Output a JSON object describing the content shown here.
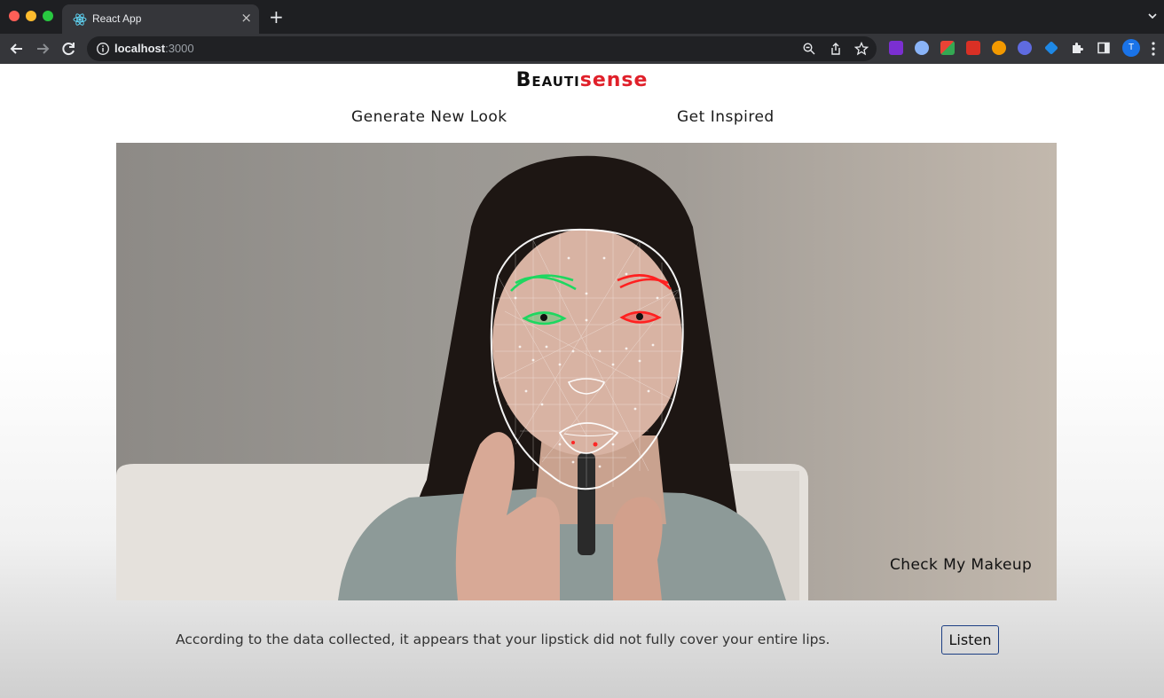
{
  "browser": {
    "tab_title": "React App",
    "url_host": "localhost",
    "url_port": ":3000",
    "profile_initial": "T"
  },
  "header": {
    "logo_part1": "Beauti",
    "logo_part2": "sense",
    "brand_colors": {
      "dark": "#111111",
      "accent": "#e0202a"
    }
  },
  "nav": {
    "items": [
      {
        "label": "Generate New Look"
      },
      {
        "label": "Get Inspired"
      }
    ]
  },
  "camera": {
    "check_label": "Check My Makeup",
    "overlay_colors": {
      "left_features": "#1ed760",
      "right_features": "#ff2020",
      "mesh": "#ffffff"
    }
  },
  "feedback": {
    "message": "According to the data collected, it appears that your lipstick did not fully cover your entire lips.",
    "listen_label": "Listen"
  },
  "icons": [
    "react-icon",
    "close-icon",
    "plus-icon",
    "back-icon",
    "forward-icon",
    "reload-icon",
    "info-icon",
    "zoom-icon",
    "share-icon",
    "star-icon",
    "extensions-icon",
    "sidepanel-icon",
    "menu-icon"
  ]
}
